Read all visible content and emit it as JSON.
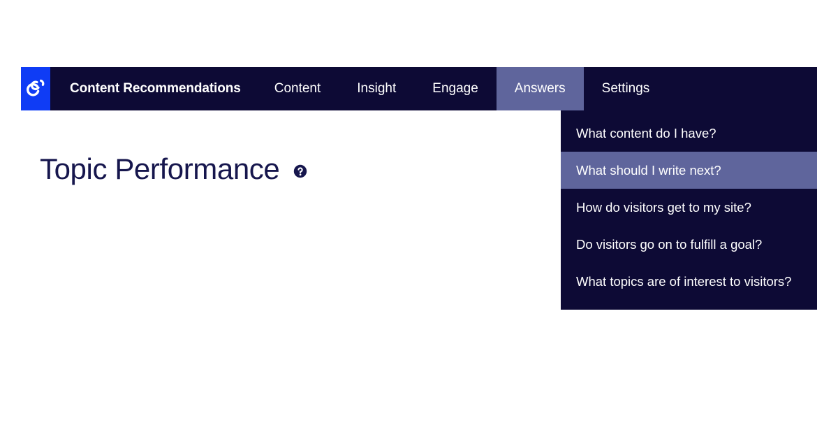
{
  "header": {
    "brand_name": "Content Recommendations",
    "logo_icon": "gathercontent-swoosh-logo",
    "logo_bg_color": "#0f3cf5",
    "bar_bg_color": "#0d0a35",
    "active_bg_color": "#5f659c",
    "nav_items": [
      {
        "label": "Content",
        "active": false
      },
      {
        "label": "Insight",
        "active": false
      },
      {
        "label": "Engage",
        "active": false
      },
      {
        "label": "Answers",
        "active": true
      },
      {
        "label": "Settings",
        "active": false
      }
    ]
  },
  "dropdown": {
    "owner": "Answers",
    "bg_color": "#0d0a35",
    "highlight_color": "#5f659c",
    "items": [
      {
        "label": "What content do I have?",
        "highlighted": false
      },
      {
        "label": "What should I write next?",
        "highlighted": true
      },
      {
        "label": "How do visitors get to my site?",
        "highlighted": false
      },
      {
        "label": "Do visitors go on to fulfill a goal?",
        "highlighted": false
      },
      {
        "label": "What topics are of interest to visitors?",
        "highlighted": false
      }
    ]
  },
  "main": {
    "page_title": "Topic Performance",
    "help_icon": "question-mark-circle-icon",
    "title_color": "#16164d"
  }
}
